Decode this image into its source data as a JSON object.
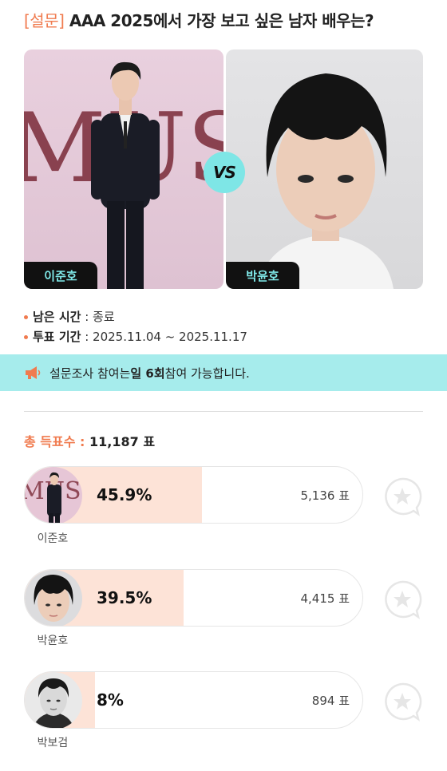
{
  "survey": {
    "tag": "[설문]",
    "question": "AAA 2025에서 가장 보고 싶은 남자 배우는?"
  },
  "matchup": {
    "left_name": "이준호",
    "right_name": "박윤호",
    "vs_label": "VS",
    "backdrop_text": "MUST"
  },
  "info": {
    "remaining_label": "남은 시간",
    "remaining_value": ": 종료",
    "period_label": "투표 기간",
    "period_value": ": 2025.11.04 ~ 2025.11.17"
  },
  "notice": {
    "prefix": "설문조사 참여는 ",
    "highlight": "일 6회",
    "suffix": " 참여 가능합니다."
  },
  "total": {
    "label": "총 득표수 :",
    "value": "11,187 표"
  },
  "candidates": [
    {
      "name": "이준호",
      "percent_label": "45.9%",
      "percent": 45.9,
      "votes": "5,136 표"
    },
    {
      "name": "박윤호",
      "percent_label": "39.5%",
      "percent": 39.5,
      "votes": "4,415 표"
    },
    {
      "name": "박보검",
      "percent_label": "8%",
      "percent": 8,
      "votes": "894 표"
    }
  ],
  "colors": {
    "accent": "#f07b4f",
    "teal": "#7fe8e8",
    "bar_fill": "#fde3d7"
  }
}
